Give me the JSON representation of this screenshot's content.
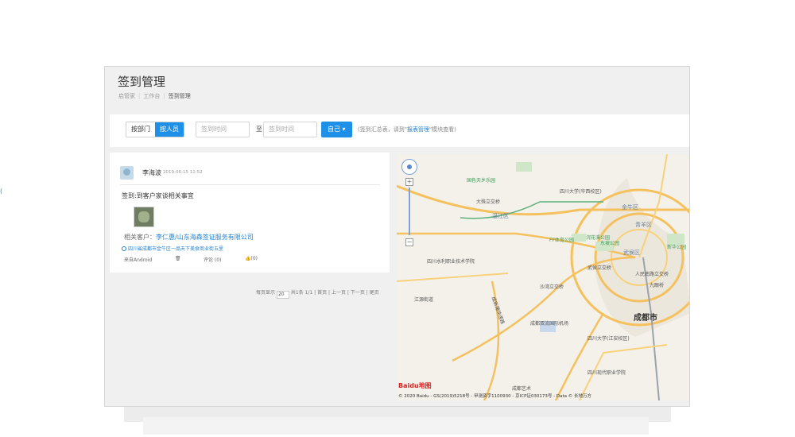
{
  "page": {
    "title": "签到管理",
    "breadcrumb": [
      "启管家",
      "工作台",
      "签到管理"
    ]
  },
  "toolbar": {
    "tabs": [
      {
        "label": "按部门",
        "active": false
      },
      {
        "label": "按人员",
        "active": true
      }
    ],
    "date_start_placeholder": "签到时间",
    "date_to": "至",
    "date_end_placeholder": "签到时间",
    "self_button": "自己",
    "hint_prefix": "(签到汇总表，请到\"",
    "hint_link": "报表管理",
    "hint_suffix": "\"模块查看)"
  },
  "record": {
    "user_name": "李海波",
    "time": "2019-06-15 11:52",
    "title": "签到:到客户家谈相关事宜",
    "customer_label": "相关客户：",
    "customer_value": "李仁惠/山东海森签证服务有限公司",
    "address": "四川省成都市金牛区一品天下美食商业街五里",
    "source": "来自Android",
    "comment": "评论 (0)",
    "like": "(0)"
  },
  "pager": {
    "per_page_label": "每页显示",
    "per_page_value": "20",
    "summary": "共1条 1/1",
    "first": "首页",
    "prev": "上一页",
    "next": "下一页",
    "last": "尾页"
  },
  "map": {
    "labels": {
      "chengdu": "成都市",
      "jinniu": "金牛区",
      "qingyang": "青羊区",
      "wuhou": "武侯区",
      "wenjiang": "温江区",
      "shuangliu_airport": "成都双流国际机场",
      "scu": "四川大学(华西校区)",
      "ff": "FF体育公园",
      "huaxi": "四川大学(江安校区)",
      "jiangan": "江源街道",
      "expressway": "成新蒲快速路",
      "wanghuan": "浣花溪公园",
      "dayuan": "大殊立交桥",
      "guose": "国色天乡乐园",
      "jiaotong": "四川水利职业技术学院",
      "xintang": "新华公园",
      "dongpo": "东坡公园",
      "renmin": "人民南路立交桥",
      "wuhouci": "武侯立交桥",
      "jiuyan": "九眼桥",
      "shahe": "沙湾立交桥",
      "modern": "四川现代职业学院",
      "chengdu_art": "成都艺术"
    },
    "logo": "Baidu地图",
    "copyright": "© 2020 Baidu - GS(2019)5218号 - 甲测资字1100930 - 京ICP证030173号 - Data © 长地万方"
  },
  "colors": {
    "accent": "#1e90e8",
    "link": "#1e7fd0"
  }
}
